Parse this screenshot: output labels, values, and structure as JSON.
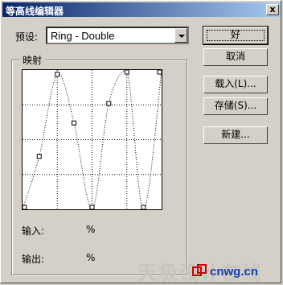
{
  "window": {
    "title": "等高线编辑器",
    "close_label": "x"
  },
  "preset": {
    "label": "预设:",
    "value": "Ring - Double"
  },
  "mapping": {
    "group_title": "映射",
    "input_label": "输入:",
    "input_value": "%",
    "output_label": "输出:",
    "output_value": "%"
  },
  "buttons": {
    "ok": "好",
    "cancel": "取消",
    "load": "载入(L)...",
    "save": "存储(S)...",
    "new": "新建..."
  },
  "watermark": {
    "text": "天极设计在线",
    "logo": "cnwg.cn"
  },
  "chart_data": {
    "type": "line",
    "title": "",
    "xlabel": "",
    "ylabel": "",
    "xlim": [
      0,
      100
    ],
    "ylim": [
      0,
      100
    ],
    "grid": true,
    "series": [
      {
        "x": [
          0,
          12,
          25,
          37,
          50,
          62,
          75,
          87,
          100
        ],
        "y": [
          0,
          38,
          97,
          62,
          0,
          76,
          100,
          0,
          100
        ]
      }
    ]
  }
}
